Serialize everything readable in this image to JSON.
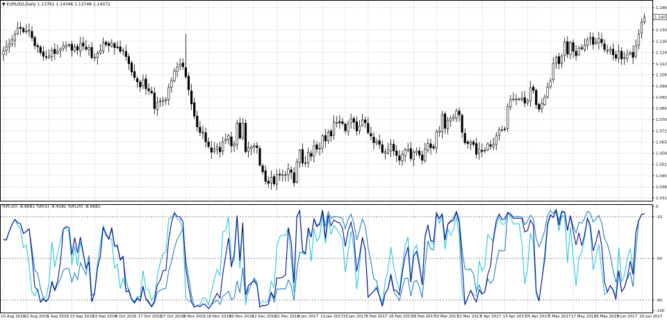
{
  "main_header": {
    "arrow": "▼",
    "symbol": "EURUSD,Daily",
    "ohlc": "1.13761 1.14346 1.13748 1.14072"
  },
  "osc_header": {
    "wpr10": "%R(10) -8.6681",
    "wpr5": "%R(5) -9.4581",
    "wpr20": "%R(20) -8.6681"
  },
  "colors": {
    "background": "#ffffff",
    "grid": "#c8c8c8",
    "candle": "#000000",
    "wpr10": "#0a0a8c",
    "wpr5": "#28c8dc",
    "wpr20": "#2080c0",
    "current_price_box": "#ffffff"
  },
  "chart_data": [
    {
      "type": "candlestick",
      "ylim": [
        1.0318,
        1.1464
      ],
      "y_ticks": [
        "1.14640",
        "1.13300",
        "1.12620",
        "1.11940",
        "1.11260",
        "1.10600",
        "1.09920",
        "1.09240",
        "1.08580",
        "1.07900",
        "1.07220",
        "1.06540",
        "1.05880",
        "1.05200",
        "1.04520",
        "1.03840",
        "1.03180"
      ],
      "y_tick_values": [
        1.1464,
        1.133,
        1.1262,
        1.1194,
        1.1126,
        1.106,
        1.0992,
        1.0924,
        1.0858,
        1.079,
        1.0722,
        1.0654,
        1.0588,
        1.052,
        1.0452,
        1.0384,
        1.0318
      ],
      "current_price": "1.14072",
      "current_price_value": 1.14072,
      "close": [
        1.1202,
        1.1228,
        1.1246,
        1.1271,
        1.1303,
        1.1342,
        1.1339,
        1.1318,
        1.1322,
        1.1328,
        1.1283,
        1.1234,
        1.1228,
        1.1193,
        1.1171,
        1.1164,
        1.1173,
        1.1206,
        1.1187,
        1.1201,
        1.1214,
        1.1234,
        1.1238,
        1.1237,
        1.1207,
        1.1227,
        1.1209,
        1.1246,
        1.1232,
        1.1214,
        1.1224,
        1.1163,
        1.1165,
        1.1189,
        1.1208,
        1.1254,
        1.1242,
        1.1235,
        1.1251,
        1.1223,
        1.1223,
        1.1201,
        1.1206,
        1.1169,
        1.1127,
        1.1076,
        1.1043,
        1.1017,
        1.0986,
        1.1029,
        1.0976,
        1.0964,
        1.0951,
        1.0856,
        1.0893,
        1.0901,
        1.0907,
        1.0909,
        1.0983,
        1.1025,
        1.1083,
        1.1105,
        1.1124,
        1.1108,
        1.1048,
        1.0969,
        1.0884,
        1.0811,
        1.0746,
        1.0712,
        1.0712,
        1.0656,
        1.0628,
        1.0594,
        1.0612,
        1.0627,
        1.0596,
        1.0655,
        1.0673,
        1.0692,
        1.0631,
        1.0642,
        1.0767,
        1.0678,
        1.0767,
        1.0597,
        1.0621,
        1.0626,
        1.0631,
        1.0621,
        1.0515,
        1.0475,
        1.0418,
        1.0406,
        1.0442,
        1.0403,
        1.0457,
        1.0456,
        1.0458,
        1.0457,
        1.0494,
        1.0472,
        1.0409,
        1.0536,
        1.0604,
        1.0528,
        1.0527,
        1.0593,
        1.0569,
        1.0632,
        1.0612,
        1.0618,
        1.0692,
        1.0661,
        1.0714,
        1.0691,
        1.0774,
        1.0773,
        1.0771,
        1.0766,
        1.0723,
        1.0763,
        1.0795,
        1.0774,
        1.0721,
        1.0752,
        1.0787,
        1.0771,
        1.0711,
        1.0691,
        1.0651,
        1.0657,
        1.064,
        1.0592,
        1.0596,
        1.0608,
        1.0641,
        1.0601,
        1.0574,
        1.0545,
        1.0579,
        1.0609,
        1.0609,
        1.0555,
        1.0594,
        1.0601,
        1.0577,
        1.0545,
        1.0612,
        1.0646,
        1.0621,
        1.0619,
        1.0717,
        1.0723,
        1.0818,
        1.0737,
        1.0786,
        1.0796,
        1.0806,
        1.0841,
        1.0818,
        1.0713,
        1.0651,
        1.0646,
        1.0656,
        1.064,
        1.0581,
        1.0611,
        1.0598,
        1.0605,
        1.0644,
        1.063,
        1.0641,
        1.0692,
        1.073,
        1.0728,
        1.0729,
        1.0869,
        1.0909,
        1.0913,
        1.0914,
        1.0914,
        1.0918,
        1.0889,
        1.0905,
        1.0981,
        1.0966,
        1.088,
        1.0852,
        1.0887,
        1.0924,
        1.0986,
        1.1024,
        1.1128,
        1.1165,
        1.1126,
        1.1172,
        1.1258,
        1.1184,
        1.1252,
        1.1201,
        1.1174,
        1.122,
        1.1217,
        1.1238,
        1.127,
        1.1284,
        1.1243,
        1.1258,
        1.1279,
        1.1253,
        1.1212,
        1.1207,
        1.1214,
        1.118,
        1.116,
        1.1203,
        1.1155,
        1.1163,
        1.118,
        1.1192,
        1.1164,
        1.1234,
        1.1305,
        1.1376,
        1.1407
      ]
    },
    {
      "type": "line",
      "ylim": [
        -100,
        0
      ],
      "y_ticks": [
        "0",
        "-10",
        "-50",
        "-90",
        "-100"
      ],
      "y_tick_values": [
        0,
        -10,
        -50,
        -90,
        -100
      ],
      "levels": [
        -10,
        -50,
        -90
      ],
      "x_labels": [
        "10 Aug 2016",
        "22 Aug 2016",
        "1 Sep 2016",
        "13 Sep 2016",
        "23 Sep 2016",
        "5 Oct 2016",
        "17 Oct 2016",
        "27 Oct 2016",
        "8 Nov 2016",
        "18 Nov 2016",
        "30 Nov 2016",
        "12 Dec 2016",
        "22 Dec 2016",
        "3 Jan 2017",
        "13 Jan 2017",
        "25 Jan 2017",
        "6 Feb 2017",
        "16 Feb 2017",
        "28 Feb 2017",
        "10 Mar 2017",
        "22 Mar 2017",
        "3 Apr 2017",
        "13 Apr 2017",
        "25 Apr 2017",
        "5 May 2017",
        "17 May 2017",
        "29 May 2017",
        "8 Jun 2017",
        "20 Jun 2017"
      ],
      "x_label_bars": [
        0,
        8,
        16,
        24,
        32,
        40,
        48,
        56,
        64,
        72,
        80,
        88,
        96,
        104,
        112,
        120,
        128,
        136,
        144,
        152,
        160,
        168,
        176,
        184,
        192,
        200,
        208,
        216,
        224
      ],
      "series": [
        {
          "name": "%R(10)",
          "periods": 10
        },
        {
          "name": "%R(5)",
          "periods": 5
        },
        {
          "name": "%R(20)",
          "periods": 20
        }
      ]
    }
  ]
}
